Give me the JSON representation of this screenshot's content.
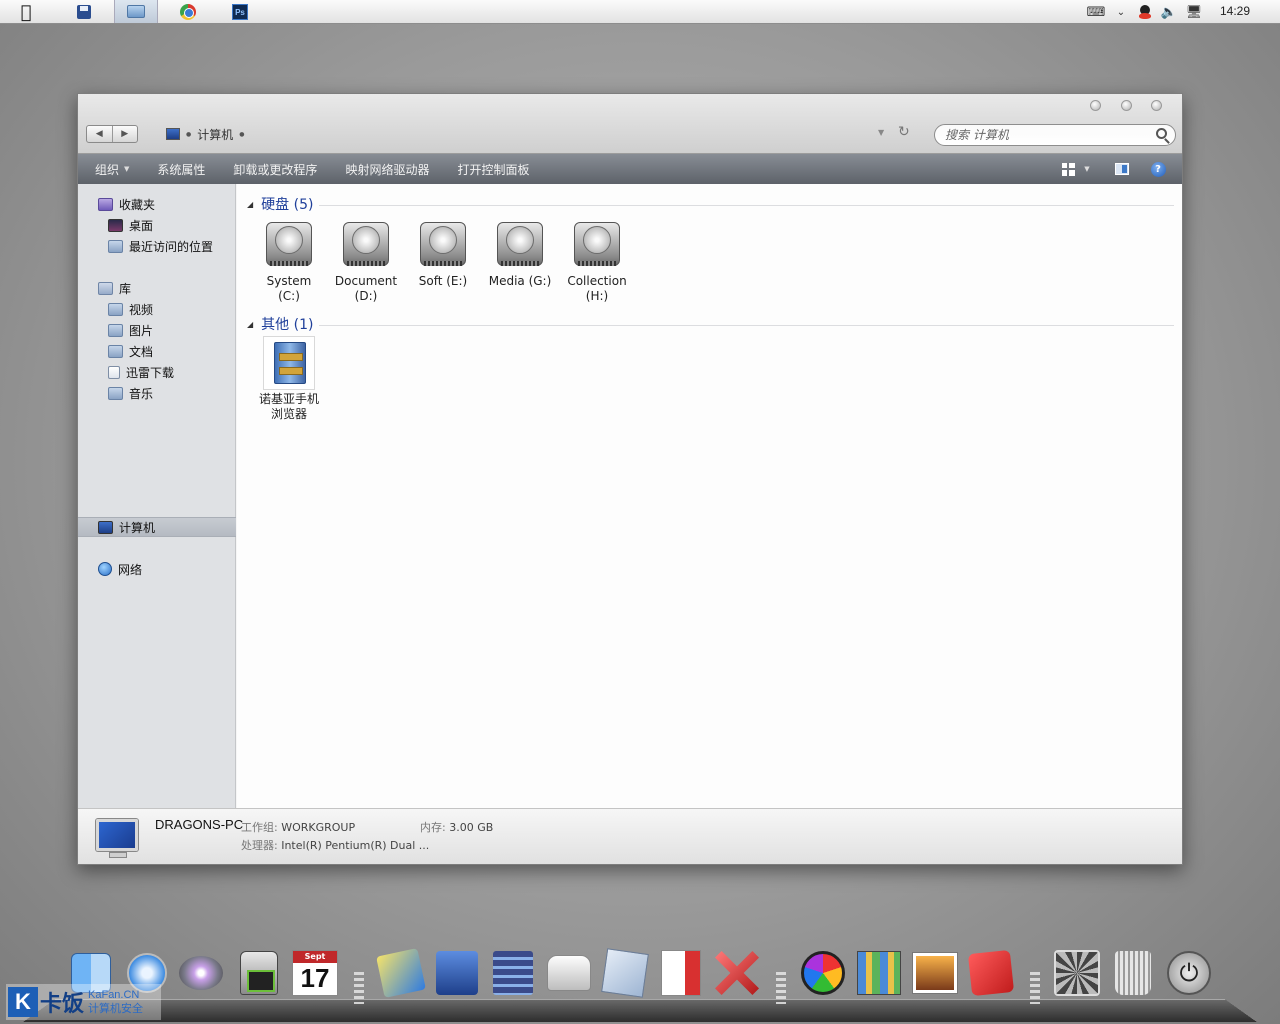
{
  "menubar": {
    "clock": "14:29",
    "app_icons": [
      "floppy-icon",
      "folder-icon",
      "chrome-icon",
      "photoshop-icon"
    ],
    "photoshop_label": "Ps"
  },
  "window": {
    "address": {
      "location": "计算机"
    },
    "search": {
      "placeholder": "搜索 计算机"
    },
    "toolbar": {
      "organize": "组织",
      "system_properties": "系统属性",
      "uninstall": "卸载或更改程序",
      "map_drive": "映射网络驱动器",
      "control_panel": "打开控制面板"
    },
    "nav": {
      "favorites": "收藏夹",
      "desktop": "桌面",
      "recent": "最近访问的位置",
      "libraries": "库",
      "videos": "视频",
      "pictures": "图片",
      "documents": "文档",
      "thunder_downloads": "迅雷下载",
      "music": "音乐",
      "computer": "计算机",
      "network": "网络"
    },
    "groups": {
      "hard_disks": {
        "title": "硬盘 (5)"
      },
      "other": {
        "title": "其他 (1)"
      }
    },
    "drives": [
      {
        "name": "System (C:)"
      },
      {
        "name": "Document (D:)"
      },
      {
        "name": "Soft (E:)"
      },
      {
        "name": "Media (G:)"
      },
      {
        "name": "Collection (H:)"
      }
    ],
    "other_items": [
      {
        "name": "诺基亚手机浏览器"
      }
    ],
    "details": {
      "pc_name": "DRAGONS-PC",
      "workgroup_label": "工作组:",
      "workgroup": "WORKGROUP",
      "memory_label": "内存:",
      "memory": "3.00 GB",
      "cpu_label": "处理器:",
      "cpu": "Intel(R) Pentium(R) Dual ..."
    }
  },
  "dock": {
    "calendar_month": "Sept",
    "calendar_day": "17"
  },
  "watermark": {
    "letter": "K",
    "title": "卡饭",
    "domain": "KaFan.CN",
    "subtitle": "计算机安全"
  }
}
